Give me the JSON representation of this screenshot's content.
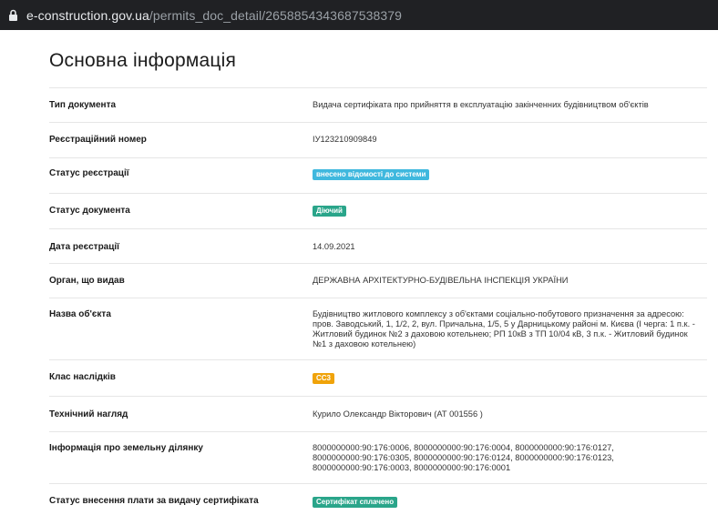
{
  "browser": {
    "url_host": "e-construction.gov.ua",
    "url_path": "/permits_doc_detail/2658854343687538379"
  },
  "page": {
    "title": "Основна інформація"
  },
  "fields": {
    "doc_type": {
      "label": "Тип документа",
      "value": "Видача сертифіката про прийняття в експлуатацію закінченних будівництвом об'єктів"
    },
    "reg_number": {
      "label": "Реєстраційний номер",
      "value": "ІУ123210909849"
    },
    "reg_status": {
      "label": "Статус реєстрації",
      "value": "внесено відомості до системи"
    },
    "doc_status": {
      "label": "Статус документа",
      "value": "Діючий"
    },
    "reg_date": {
      "label": "Дата реєстрації",
      "value": "14.09.2021"
    },
    "issuer": {
      "label": "Орган, що видав",
      "value": "ДЕРЖАВНА АРХІТЕКТУРНО-БУДІВЕЛЬНА ІНСПЕКЦІЯ УКРАЇНИ"
    },
    "object_name": {
      "label": "Назва об'єкта",
      "value": "Будівництво житлового комплексу з об'єктами соціально-побутового призначення за адресою: пров. Заводський, 1, 1/2, 2, вул. Причальна, 1/5, 5 у Дарницькому районі м. Києва (І черга: 1 п.к. - Житловий будинок №2 з даховою котельнею; РП 10кВ з ТП 10/04 кВ, 3 п.к. - Житловий будинок №1 з даховою котельнею)"
    },
    "consequence_class": {
      "label": "Клас наслідків",
      "value": "СС3"
    },
    "tech_supervision": {
      "label": "Технічний нагляд",
      "value": "Курило Олександр Вікторович (АТ 001556 )"
    },
    "land_info": {
      "label": "Інформація про земельну ділянку",
      "value": "8000000000:90:176:0006, 8000000000:90:176:0004, 8000000000:90:176:0127, 8000000000:90:176:0305, 8000000000:90:176:0124, 8000000000:90:176:0123, 8000000000:90:176:0003, 8000000000:90:176:0001"
    },
    "fee_status": {
      "label": "Статус внесення плати за видачу сертифіката",
      "value": "Сертифікат сплачено"
    }
  },
  "colors": {
    "badge_blue": "#3fb8de",
    "badge_green": "#2aa58a",
    "badge_orange": "#f0a30a"
  },
  "icons": {
    "lock": "lock-icon"
  }
}
